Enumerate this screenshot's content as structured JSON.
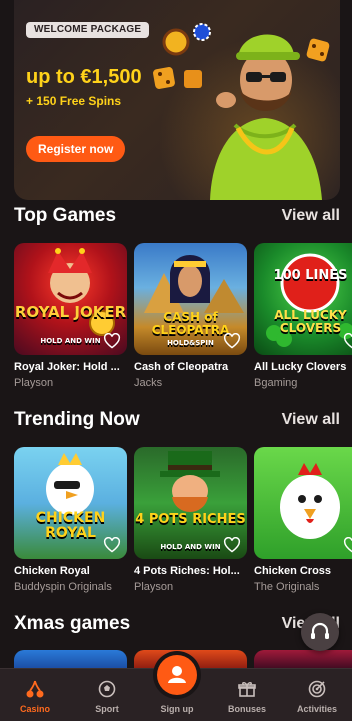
{
  "banner": {
    "pill": "WELCOME PACKAGE",
    "headline": "up to €1,500",
    "subline": "+ 150 Free Spins",
    "register_label": "Register now"
  },
  "sections": [
    {
      "title": "Top Games",
      "view_all": "View all",
      "games": [
        {
          "name": "Royal Joker: Hold ...",
          "provider": "Playson",
          "art_text": "ROYAL JOKER",
          "art_sub": "HOLD AND WIN"
        },
        {
          "name": "Cash of Cleopatra",
          "provider": "Jacks",
          "art_text": "CASH of CLEOPATRA",
          "art_sub": "HOLD&SPIN"
        },
        {
          "name": "All Lucky Clovers",
          "provider": "Bgaming",
          "art_text": "ALL LUCKY CLOVERS",
          "art_sub": "100 LINES"
        }
      ]
    },
    {
      "title": "Trending Now",
      "view_all": "View all",
      "games": [
        {
          "name": "Chicken Royal",
          "provider": "Buddyspin Originals",
          "art_text": "CHICKEN ROYAL"
        },
        {
          "name": "4 Pots Riches: Hol...",
          "provider": "Playson",
          "art_text": "4 POTS RICHES",
          "art_sub": "HOLD AND WIN"
        },
        {
          "name": "Chicken Cross",
          "provider": "The Originals"
        }
      ]
    },
    {
      "title": "Xmas games",
      "view_all": "View all"
    }
  ],
  "nav": {
    "items": [
      {
        "label": "Casino",
        "icon": "cherries-icon",
        "active": true
      },
      {
        "label": "Sport",
        "icon": "soccer-ball-icon"
      },
      {
        "label": "Sign up",
        "icon": "user-icon"
      },
      {
        "label": "Bonuses",
        "icon": "gift-icon"
      },
      {
        "label": "Activities",
        "icon": "target-icon"
      }
    ]
  },
  "colors": {
    "background": "#1a1516",
    "accent": "#ff5a14",
    "yellow": "#ffd21a",
    "muted": "#a59b98"
  }
}
